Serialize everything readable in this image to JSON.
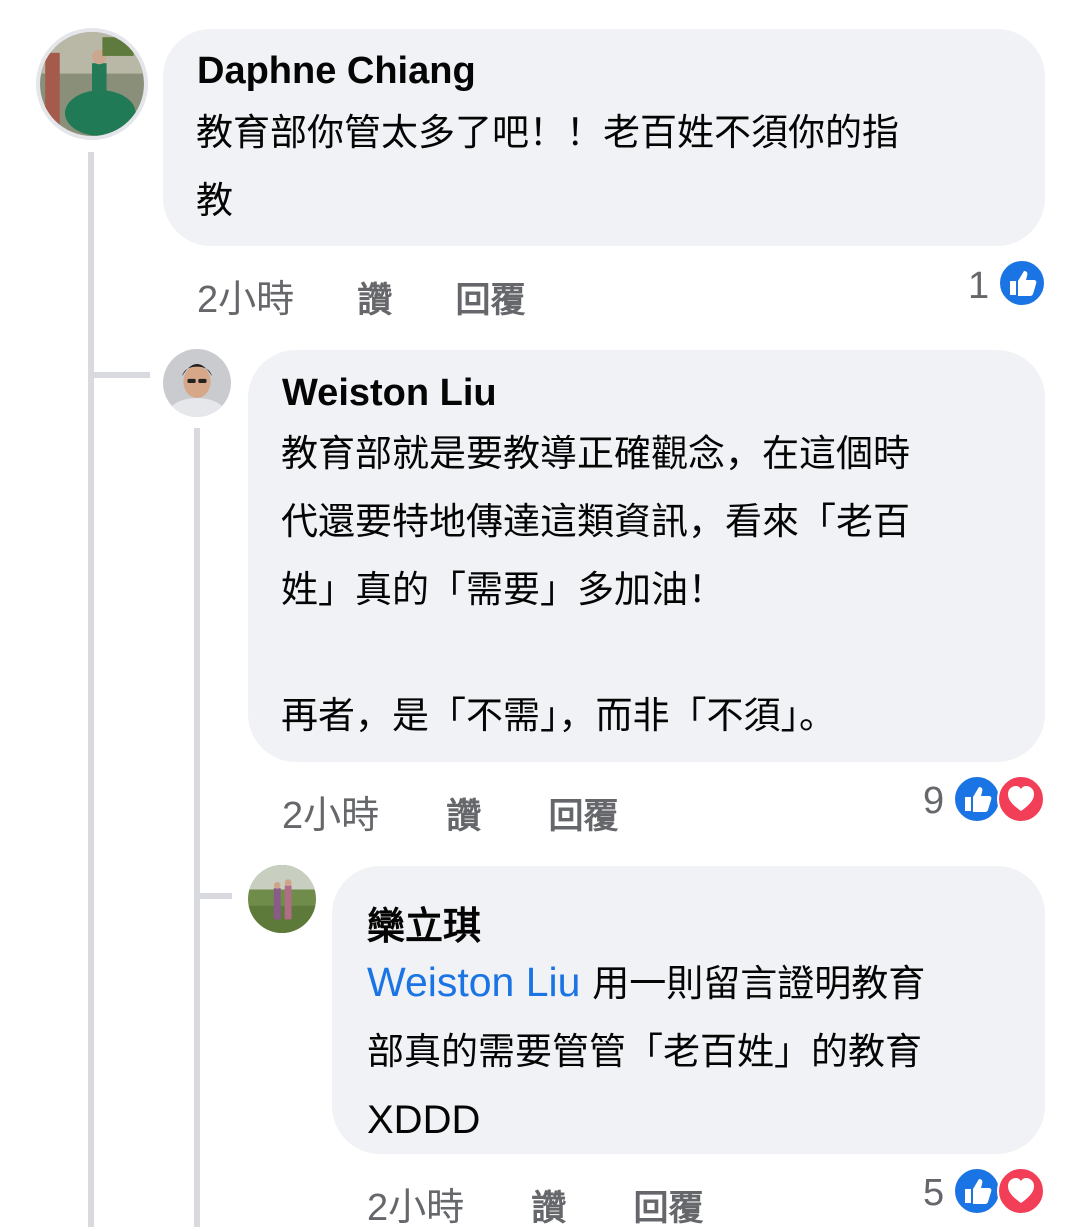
{
  "comments": [
    {
      "author": "Daphne Chiang",
      "text_lines": [
        "教育部你管太多了吧！！老百姓不須你的指",
        "教"
      ],
      "time": "2小時",
      "like_label": "讚",
      "reply_label": "回覆",
      "reaction_count": "1",
      "reactions": [
        "like-icon"
      ]
    },
    {
      "author": "Weiston Liu",
      "text_lines": [
        "教育部就是要教導正確觀念，在這個時",
        "代還要特地傳達這類資訊，看來「老百",
        "姓」真的「需要」多加油！",
        "",
        "再者，是「不需」，而非「不須」。"
      ],
      "time": "2小時",
      "like_label": "讚",
      "reply_label": "回覆",
      "reaction_count": "9",
      "reactions": [
        "like-icon",
        "love-icon"
      ]
    },
    {
      "author": "欒立琪",
      "mention": "Weiston Liu",
      "text_line1_rest": " 用一則留言證明教育",
      "text_lines": [
        "部真的需要管管「老百姓」的教育",
        "XDDD"
      ],
      "time": "2小時",
      "like_label": "讚",
      "reply_label": "回覆",
      "reaction_count": "5",
      "reactions": [
        "like-icon",
        "love-icon"
      ]
    }
  ],
  "colors": {
    "bubble": "#f0f2f5",
    "like_blue": "#1b74e4",
    "love_red": "#f33e58",
    "meta_gray": "#65676b"
  }
}
